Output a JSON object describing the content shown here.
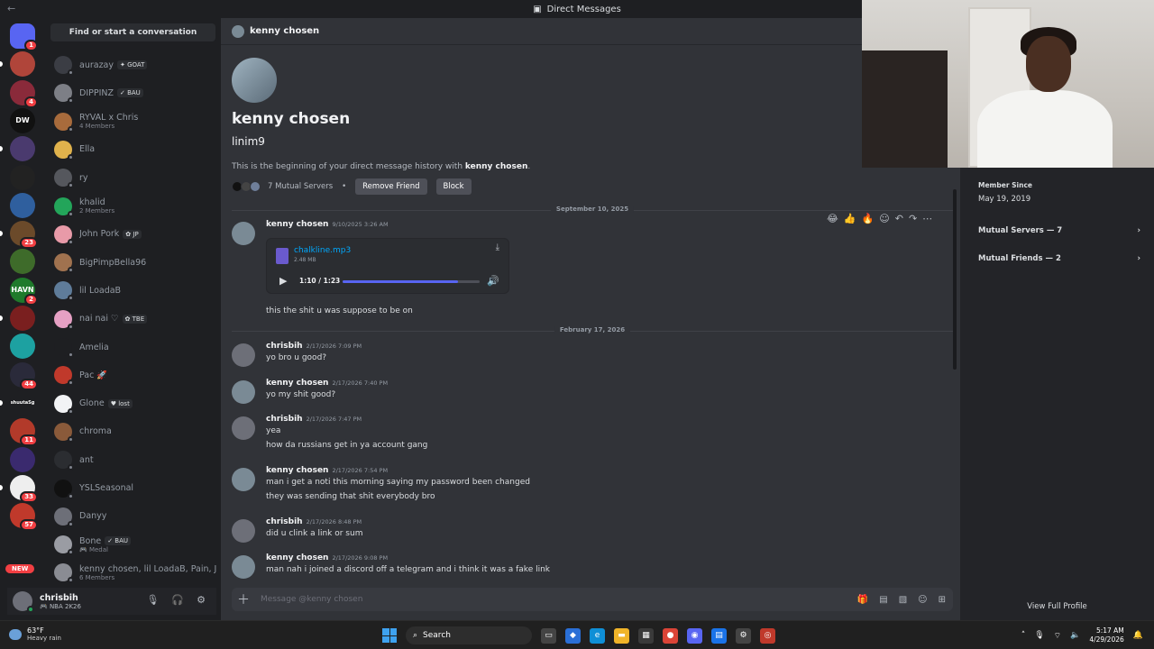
{
  "titlebar": {
    "title": "Direct Messages"
  },
  "servers": [
    {
      "color": "#5865f2",
      "badge": "1",
      "label": ""
    },
    {
      "color": "#b0453a",
      "badge": "",
      "label": ""
    },
    {
      "color": "#8a2a3a",
      "badge": "4",
      "label": ""
    },
    {
      "color": "#111111",
      "badge": "",
      "label": "DW"
    },
    {
      "color": "#4a3a6e",
      "badge": "",
      "label": ""
    },
    {
      "color": "#222222",
      "badge": "",
      "label": ""
    },
    {
      "color": "#2f5f9e",
      "badge": "",
      "label": ""
    },
    {
      "color": "#6b4a2a",
      "badge": "23",
      "label": ""
    },
    {
      "color": "#3e6b2a",
      "badge": "",
      "label": ""
    },
    {
      "color": "#1f7a2b",
      "badge": "2",
      "label": "HAVN"
    },
    {
      "color": "#7a1f1f",
      "badge": "",
      "label": ""
    },
    {
      "color": "#1da1a1",
      "badge": "",
      "label": ""
    },
    {
      "color": "#2a2a3a",
      "badge": "44",
      "label": ""
    },
    {
      "color": "#1e1f22",
      "badge": "",
      "label": "shuutaSg"
    },
    {
      "color": "#b23a2a",
      "badge": "11",
      "label": ""
    },
    {
      "color": "#3a2a6e",
      "badge": "",
      "label": ""
    },
    {
      "color": "#eeeeee",
      "badge": "33",
      "label": ""
    },
    {
      "color": "#c0392b",
      "badge": "57",
      "label": ""
    }
  ],
  "rail_new": "NEW",
  "sidebar": {
    "find": "Find or start a conversation",
    "dms": [
      {
        "name": "aurazay",
        "sub": "",
        "tag": "✦ GOAT",
        "color": "#3b3d44"
      },
      {
        "name": "DIPPINZ",
        "sub": "",
        "tag": "✓ BAU",
        "color": "#7d7f86"
      },
      {
        "name": "RYVAL x Chris",
        "sub": "4 Members",
        "tag": "",
        "color": "#a86b3c"
      },
      {
        "name": "Ella",
        "sub": "",
        "tag": "",
        "color": "#e0b24c"
      },
      {
        "name": "ry",
        "sub": "",
        "tag": "",
        "color": "#55575d"
      },
      {
        "name": "khalid",
        "sub": "2 Members",
        "tag": "",
        "color": "#23a55a"
      },
      {
        "name": "John Pork",
        "sub": "",
        "tag": "✿ JP",
        "color": "#e89aa8"
      },
      {
        "name": "BigPimpBella96",
        "sub": "",
        "tag": "",
        "color": "#a0724f"
      },
      {
        "name": "lil LoadaB",
        "sub": "",
        "tag": "",
        "color": "#5f7c9a"
      },
      {
        "name": "nai nai ♡",
        "sub": "",
        "tag": "✿ TBE",
        "color": "#e6a0c4"
      },
      {
        "name": "Amelia",
        "sub": "",
        "tag": "",
        "color": "#1e1f22"
      },
      {
        "name": "Pac 🚀",
        "sub": "",
        "tag": "",
        "color": "#c0392b"
      },
      {
        "name": "Glone",
        "sub": "",
        "tag": "♥ lost",
        "color": "#f2f3f5"
      },
      {
        "name": "chroma",
        "sub": "",
        "tag": "",
        "color": "#8a5a3a"
      },
      {
        "name": "ant",
        "sub": "",
        "tag": "",
        "color": "#2b2d31"
      },
      {
        "name": "YSLSeasonal",
        "sub": "",
        "tag": "",
        "color": "#111111"
      },
      {
        "name": "Danyy",
        "sub": "",
        "tag": "",
        "color": "#6d6f78"
      },
      {
        "name": "Bone",
        "sub": "🎮 Medal",
        "tag": "✓ BAU",
        "color": "#9a9ca3"
      },
      {
        "name": "kenny chosen, lil LoadaB, Pain, J...",
        "sub": "6 Members",
        "tag": "",
        "color": "#8a8c93"
      }
    ]
  },
  "user": {
    "name": "chrisbih",
    "status": "🎮 NBA 2K26"
  },
  "chat": {
    "header": "kenny chosen",
    "intro": {
      "display_name": "kenny chosen",
      "username": "linim9",
      "begin_prefix": "This is the beginning of your direct message history with ",
      "begin_name": "kenny chosen",
      "begin_suffix": ".",
      "mutual": "7 Mutual Servers",
      "dot": "•",
      "remove": "Remove Friend",
      "block": "Block"
    },
    "dividers": [
      "September 10, 2025",
      "February 17, 2026"
    ],
    "attachment": {
      "author": "kenny chosen",
      "ts": "9/10/2025 3:26 AM",
      "file": "chalkline.mp3",
      "size": "2.48 MB",
      "time": "1:10 / 1:23",
      "progress": 0.84,
      "caption": "this the shit u was suppose to be on"
    },
    "messages": [
      {
        "author": "chrisbih",
        "ts": "2/17/2026 7:09 PM",
        "lines": [
          "yo bro u good?"
        ],
        "color": "#6d6f78"
      },
      {
        "author": "kenny chosen",
        "ts": "2/17/2026 7:40 PM",
        "lines": [
          "yo my shit good?"
        ],
        "color": "#7a8a95"
      },
      {
        "author": "chrisbih",
        "ts": "2/17/2026 7:47 PM",
        "lines": [
          "yea",
          "how da russians get in ya account gang"
        ],
        "color": "#6d6f78"
      },
      {
        "author": "kenny chosen",
        "ts": "2/17/2026 7:54 PM",
        "lines": [
          "man i get a noti this morning saying my password been changed",
          "they was sending that shit everybody bro"
        ],
        "color": "#7a8a95"
      },
      {
        "author": "chrisbih",
        "ts": "2/17/2026 8:48 PM",
        "lines": [
          "did u clink a link or sum"
        ],
        "color": "#6d6f78"
      },
      {
        "author": "kenny chosen",
        "ts": "2/17/2026 9:08 PM",
        "lines": [
          "man nah i joined a discord off a telegram and i think it was a fake link"
        ],
        "color": "#7a8a95"
      }
    ],
    "composer_placeholder": "Message @kenny chosen"
  },
  "profile": {
    "member_since_label": "Member Since",
    "member_since": "May 19, 2019",
    "mutual_servers": "Mutual Servers — 7",
    "mutual_friends": "Mutual Friends — 2",
    "view_full": "View Full Profile"
  },
  "taskbar": {
    "temp": "63°F",
    "weather": "Heavy rain",
    "search": "Search",
    "time": "5:17 AM",
    "date": "4/29/2026"
  }
}
